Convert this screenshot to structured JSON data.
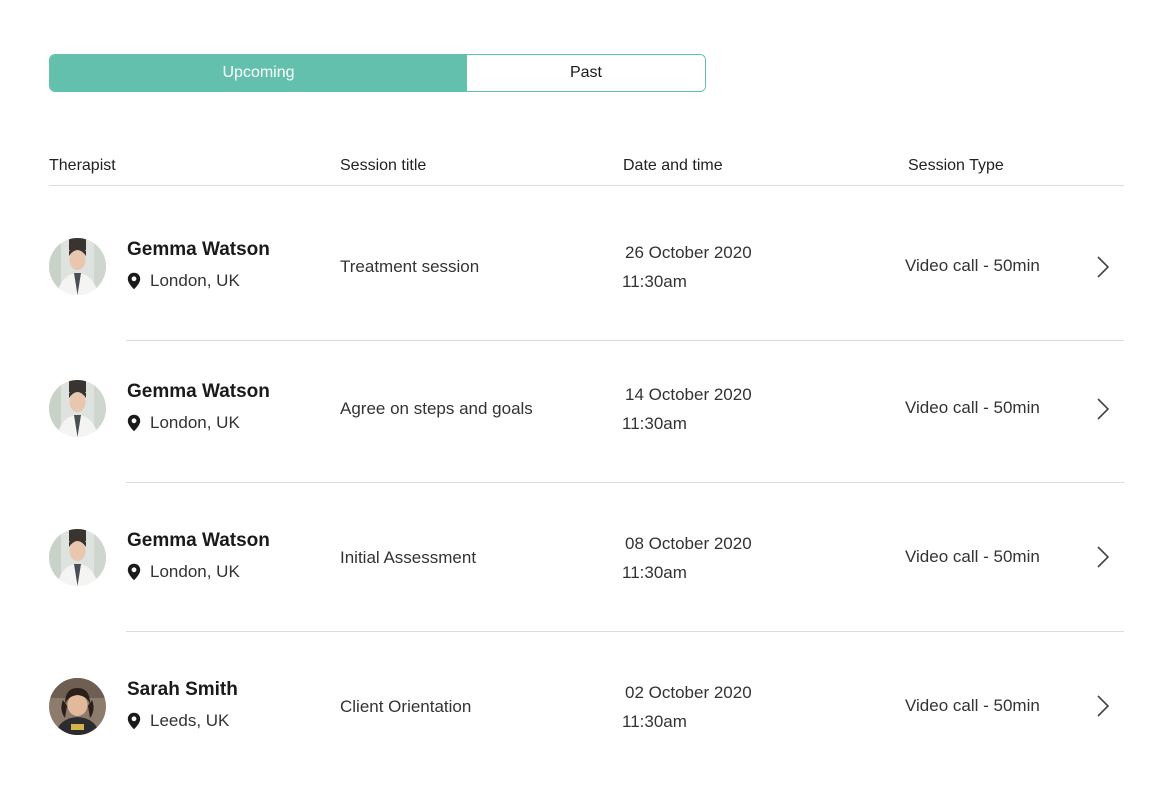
{
  "tabs": {
    "upcoming": "Upcoming",
    "past": "Past"
  },
  "columns": {
    "therapist": "Therapist",
    "session_title": "Session title",
    "date_time": "Date and time",
    "session_type": "Session Type"
  },
  "sessions": [
    {
      "therapist": "Gemma Watson",
      "location": "London, UK",
      "title": "Treatment session",
      "date": "26 October 2020",
      "time": "11:30am",
      "type": "Video call - 50min"
    },
    {
      "therapist": "Gemma Watson",
      "location": "London, UK",
      "title": "Agree on steps and goals",
      "date": "14 October 2020",
      "time": "11:30am",
      "type": "Video call - 50min"
    },
    {
      "therapist": "Gemma Watson",
      "location": "London, UK",
      "title": "Initial Assessment",
      "date": "08 October 2020",
      "time": "11:30am",
      "type": "Video call - 50min"
    },
    {
      "therapist": "Sarah Smith",
      "location": "Leeds, UK",
      "title": "Client Orientation",
      "date": "02 October 2020",
      "time": "11:30am",
      "type": "Video call - 50min"
    }
  ],
  "colors": {
    "accent": "#62c0ac",
    "divider": "#dcdcdc"
  },
  "icons": {
    "location": "map-pin-icon",
    "row_action": "chevron-right-icon",
    "avatar": "therapist-avatar"
  }
}
